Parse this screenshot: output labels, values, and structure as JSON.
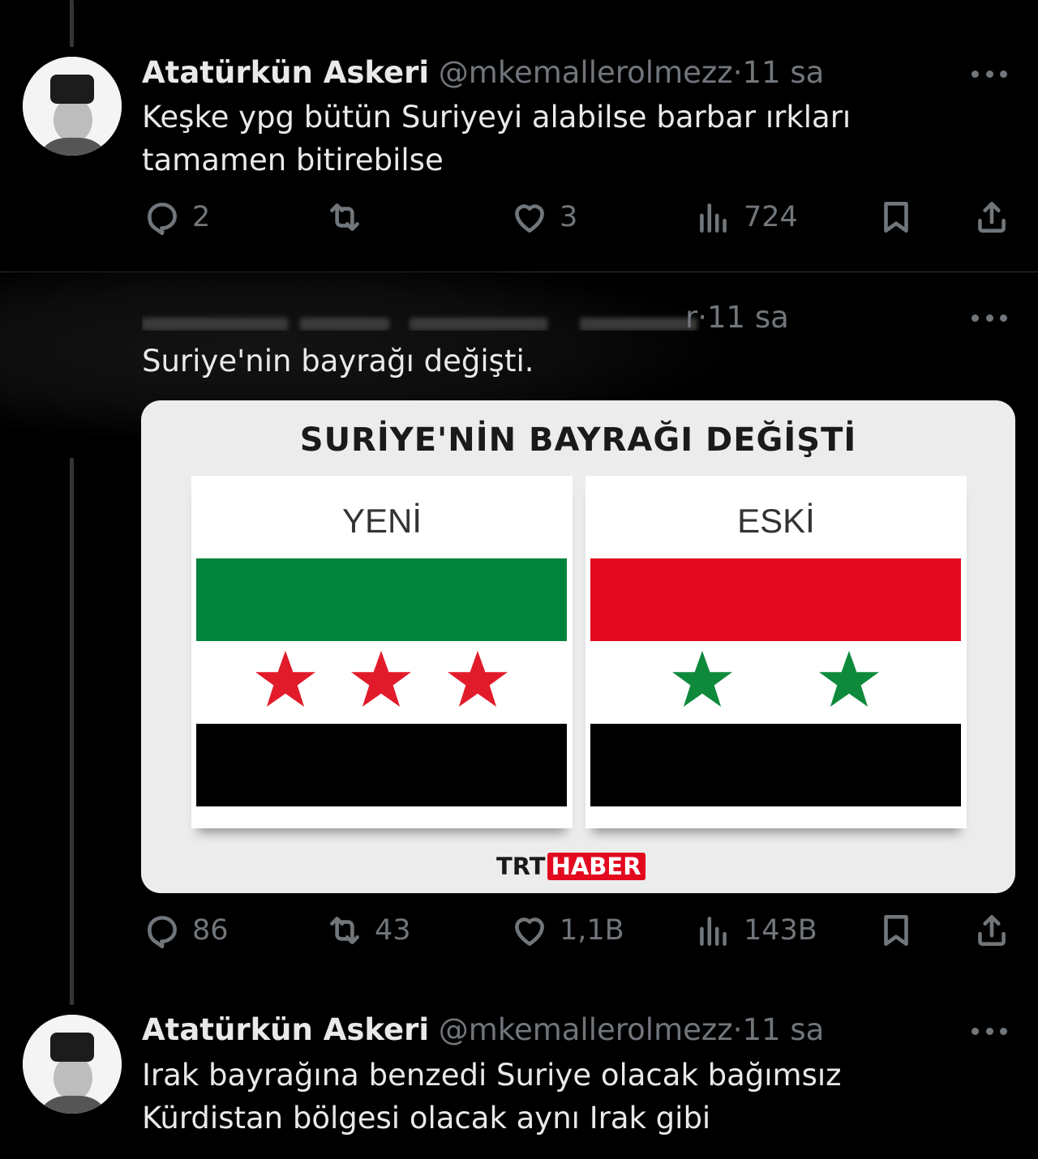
{
  "tweets": [
    {
      "name": "Atatürkün Askeri",
      "handle": "@mkemallerolmezz",
      "separator": "·",
      "time": "11 sa",
      "text": "Keşke ypg bütün Suriyeyi alabilse barbar ırkları tamamen bitirebilse",
      "stats": {
        "replies": "2",
        "retweets": "",
        "likes": "3",
        "views": "724"
      }
    },
    {
      "name_visible": "r",
      "separator": "·",
      "time": "11 sa",
      "text": "Suriye'nin bayrağı değişti.",
      "card": {
        "title": "SURİYE'NİN BAYRAĞI DEĞİŞTİ",
        "new_label": "YENİ",
        "old_label": "ESKİ",
        "new_flag_colors": [
          "#00843d",
          "#ffffff",
          "#000000"
        ],
        "new_star_color": "#e21b2a",
        "old_flag_colors": [
          "#e30a1f",
          "#ffffff",
          "#000000"
        ],
        "old_star_color": "#0f8a3c",
        "logo_left": "TRT",
        "logo_right": "HABER"
      },
      "stats": {
        "replies": "86",
        "retweets": "43",
        "likes": "1,1B",
        "views": "143B"
      }
    },
    {
      "name": "Atatürkün Askeri",
      "handle": "@mkemallerolmezz",
      "separator": "·",
      "time": "11 sa",
      "text": "Irak bayrağına benzedi Suriye olacak bağımsız Kürdistan bölgesi olacak aynı Irak gibi"
    }
  ],
  "icons": {
    "reply": "reply-icon",
    "retweet": "retweet-icon",
    "like": "heart-icon",
    "views": "views-icon",
    "bookmark": "bookmark-icon",
    "share": "share-icon",
    "more": "more-icon"
  }
}
